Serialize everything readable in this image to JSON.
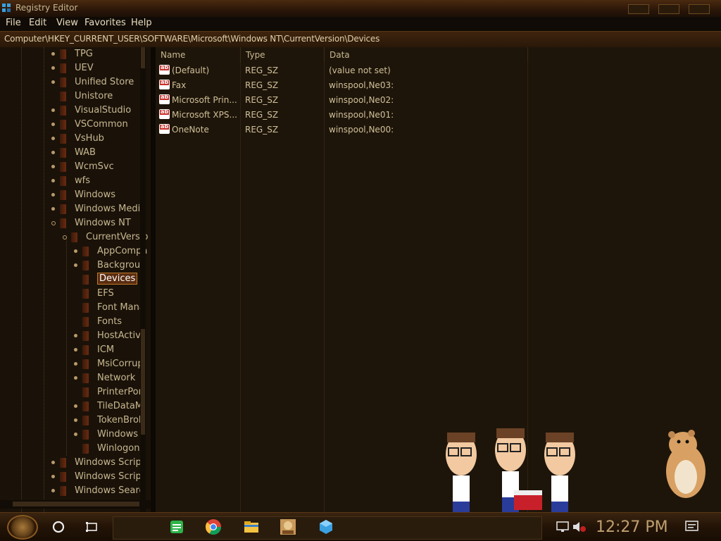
{
  "window": {
    "title": "Registry Editor"
  },
  "menu": [
    "File",
    "Edit",
    "View",
    "Favorites",
    "Help"
  ],
  "address": "Computer\\HKEY_CURRENT_USER\\SOFTWARE\\Microsoft\\Windows NT\\CurrentVersion\\Devices",
  "tree": {
    "nodes": [
      {
        "label": "TPG",
        "depth": 0,
        "expander": true
      },
      {
        "label": "UEV",
        "depth": 0,
        "expander": true
      },
      {
        "label": "Unified Store",
        "depth": 0,
        "expander": true
      },
      {
        "label": "Unistore",
        "depth": 0,
        "expander": false
      },
      {
        "label": "VisualStudio",
        "depth": 0,
        "expander": true
      },
      {
        "label": "VSCommon",
        "depth": 0,
        "expander": true
      },
      {
        "label": "VsHub",
        "depth": 0,
        "expander": true
      },
      {
        "label": "WAB",
        "depth": 0,
        "expander": true
      },
      {
        "label": "WcmSvc",
        "depth": 0,
        "expander": true
      },
      {
        "label": "wfs",
        "depth": 0,
        "expander": true
      },
      {
        "label": "Windows",
        "depth": 0,
        "expander": true
      },
      {
        "label": "Windows Media",
        "depth": 0,
        "expander": true
      },
      {
        "label": "Windows NT",
        "depth": 0,
        "expander": true,
        "expanded": true
      },
      {
        "label": "CurrentVersio",
        "depth": 1,
        "expander": true,
        "expanded": true
      },
      {
        "label": "AppCompa",
        "depth": 2,
        "expander": true
      },
      {
        "label": "Backgrour",
        "depth": 2,
        "expander": true
      },
      {
        "label": "Devices",
        "depth": 2,
        "expander": false,
        "selected": true
      },
      {
        "label": "EFS",
        "depth": 2,
        "expander": false
      },
      {
        "label": "Font Mana",
        "depth": 2,
        "expander": false
      },
      {
        "label": "Fonts",
        "depth": 2,
        "expander": false
      },
      {
        "label": "HostActivi",
        "depth": 2,
        "expander": true
      },
      {
        "label": "ICM",
        "depth": 2,
        "expander": true
      },
      {
        "label": "MsiCorrup",
        "depth": 2,
        "expander": true
      },
      {
        "label": "Network",
        "depth": 2,
        "expander": true
      },
      {
        "label": "PrinterPor",
        "depth": 2,
        "expander": false
      },
      {
        "label": "TileDataM",
        "depth": 2,
        "expander": true
      },
      {
        "label": "TokenBrok",
        "depth": 2,
        "expander": true
      },
      {
        "label": "Windows",
        "depth": 2,
        "expander": true
      },
      {
        "label": "Winlogon",
        "depth": 2,
        "expander": false
      },
      {
        "label": "Windows Script",
        "depth": 0,
        "expander": true
      },
      {
        "label": "Windows Script",
        "depth": 0,
        "expander": true
      },
      {
        "label": "Windows Searc",
        "depth": 0,
        "expander": true
      }
    ]
  },
  "list": {
    "columns": [
      "Name",
      "Type",
      "Data"
    ],
    "rows": [
      {
        "name": "(Default)",
        "type": "REG_SZ",
        "data": "(value not set)"
      },
      {
        "name": "Fax",
        "type": "REG_SZ",
        "data": "winspool,Ne03:"
      },
      {
        "name": "Microsoft Prin...",
        "type": "REG_SZ",
        "data": "winspool,Ne02:"
      },
      {
        "name": "Microsoft XPS...",
        "type": "REG_SZ",
        "data": "winspool,Ne01:"
      },
      {
        "name": "OneNote",
        "type": "REG_SZ",
        "data": "winspool,Ne00:"
      }
    ]
  },
  "taskbar": {
    "apps": [
      "start-icon",
      "cortana-icon",
      "task-view-icon",
      "notes-icon",
      "chrome-icon",
      "file-explorer-icon",
      "photo-app-icon",
      "registry-editor-icon"
    ],
    "clock": "12:27 PM"
  }
}
